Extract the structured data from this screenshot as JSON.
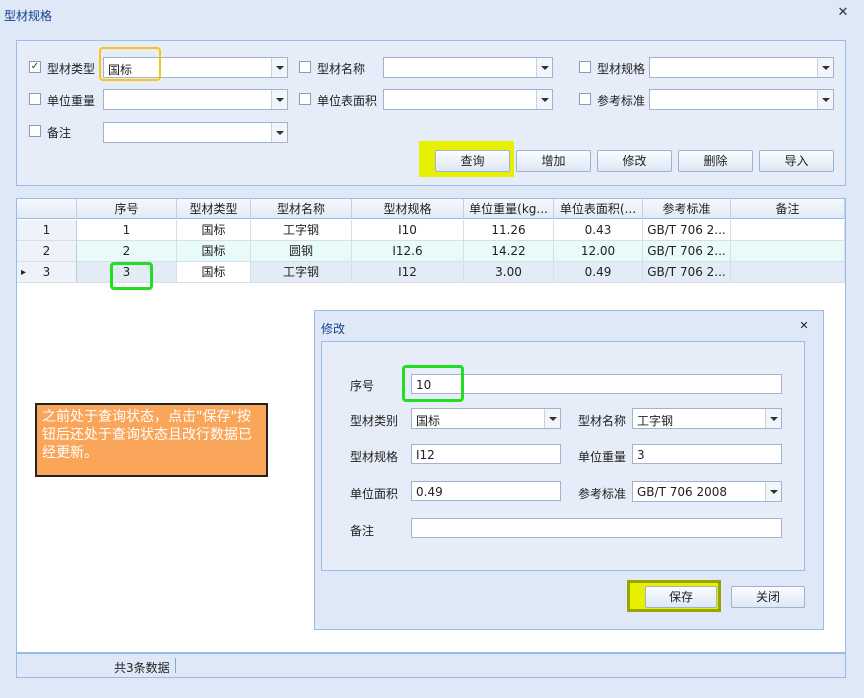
{
  "window": {
    "title": "型材规格",
    "close_icon": "close-icon"
  },
  "filters": {
    "type_label": "型材类型",
    "type_value": "国标",
    "type_checked": true,
    "name_label": "型材名称",
    "name_value": "",
    "spec_label": "型材规格",
    "spec_value": "",
    "unit_weight_label": "单位重量",
    "unit_weight_value": "",
    "unit_area_label": "单位表面积",
    "unit_area_value": "",
    "standard_label": "参考标准",
    "standard_value": "",
    "remark_label": "备注",
    "remark_value": ""
  },
  "toolbar": {
    "query": "查询",
    "add": "增加",
    "edit": "修改",
    "delete": "删除",
    "import": "导入"
  },
  "grid": {
    "columns": [
      "序号",
      "型材类型",
      "型材名称",
      "型材规格",
      "单位重量(kg...",
      "单位表面积(...",
      "参考标准",
      "备注"
    ],
    "rows": [
      {
        "row_no": "1",
        "cells": [
          "1",
          "国标",
          "工字钢",
          "I10",
          "11.26",
          "0.43",
          "GB/T 706 2...",
          ""
        ]
      },
      {
        "row_no": "2",
        "cells": [
          "2",
          "国标",
          "圆钢",
          "I12.6",
          "14.22",
          "12.00",
          "GB/T 706 2...",
          ""
        ]
      },
      {
        "row_no": "3",
        "cells": [
          "3",
          "国标",
          "工字钢",
          "I12",
          "3.00",
          "0.49",
          "GB/T 706 2...",
          ""
        ]
      }
    ],
    "current_row_marker": "▸"
  },
  "status": {
    "count": "共3条数据"
  },
  "dialog": {
    "title": "修改",
    "seq_label": "序号",
    "seq_value": "10",
    "category_label": "型材类别",
    "category_value": "国标",
    "name_label": "型材名称",
    "name_value": "工字钢",
    "spec_label": "型材规格",
    "spec_value": "I12",
    "unit_weight_label": "单位重量",
    "unit_weight_value": "3",
    "unit_area_label": "单位面积",
    "unit_area_value": "0.49",
    "standard_label": "参考标准",
    "standard_value": "GB/T 706 2008",
    "remark_label": "备注",
    "remark_value": "",
    "save": "保存",
    "close": "关闭"
  },
  "annotation": {
    "text": "之前处于查询状态，点击\"保存\"按钮后还处于查询状态且改行数据已经更新。"
  },
  "colors": {
    "accent_border": "#99bbe8",
    "highlight_yellow": "#f5c518",
    "highlight_lime": "#e6f000",
    "highlight_green": "#22dd22",
    "note_bg": "#f9a55a"
  }
}
